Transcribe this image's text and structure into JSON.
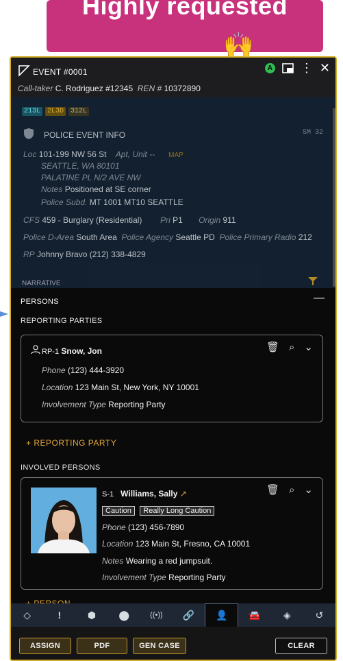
{
  "banner": {
    "text": "Highly requested",
    "emoji": "🙌"
  },
  "header": {
    "event_title": "EVENT #0001",
    "calltaker_label": "Call-taker",
    "calltaker_value": "C. Rodriguez #12345",
    "ren_label": "REN #",
    "ren_value": "10372890",
    "status_letter": "A"
  },
  "tags": [
    "213L",
    "2L3D",
    "312L"
  ],
  "police_info": {
    "title": "POLICE EVENT INFO",
    "sm": "SM 32",
    "loc_label": "Loc",
    "loc_value": "101-199 NW 56 St",
    "apt_label": "Apt, Unit --",
    "map_label": "MAP",
    "city": "SEATTLE, WA 80101",
    "cross": "PALATINE PL N/2 AVE NW",
    "notes_label": "Notes",
    "notes_value": "Positioned at SE corner",
    "subd_label": "Police Subd.",
    "subd_value": "MT 1001 MT10 SEATTLE",
    "cfs_label": "CFS",
    "cfs_value": "459 - Burglary (Residential)",
    "pri_label": "Pri",
    "pri_value": "P1",
    "origin_label": "Origin",
    "origin_value": "911",
    "darea_label": "Police D-Area",
    "darea_value": "South Area",
    "agency_label": "Police Agency",
    "agency_value": "Seattle PD",
    "radio_label": "Police Primary Radio",
    "radio_value": "212",
    "rp_label": "RP",
    "rp_value": "Johnny Bravo (212) 338-4829",
    "narrative_label": "NARRATIVE"
  },
  "persons": {
    "title": "PERSONS",
    "reporting_title": "REPORTING PARTIES",
    "rp_card": {
      "id": "RP-1",
      "name": "Snow, Jon",
      "phone_label": "Phone",
      "phone": "(123) 444-3920",
      "location_label": "Location",
      "location": "123 Main St, New York, NY 10001",
      "involvement_label": "Involvement Type",
      "involvement": "Reporting Party"
    },
    "add_rp": "+ REPORTING PARTY",
    "involved_title": "INVOLVED PERSONS",
    "s_card": {
      "id": "S-1",
      "name": "Williams, Sally",
      "caution1": "Caution",
      "caution2": "Really Long Caution",
      "phone_label": "Phone",
      "phone": "(123) 456-7890",
      "location_label": "Location",
      "location": "123 Main St, Fresno, CA 10001",
      "notes_label": "Notes",
      "notes": "Wearing a red jumpsuit.",
      "involvement_label": "Involvement Type",
      "involvement": "Reporting Party"
    },
    "add_person": "+ PERSON"
  },
  "actions": {
    "assign": "ASSIGN",
    "pdf": "PDF",
    "gen_case": "GEN CASE",
    "clear": "CLEAR"
  },
  "colors": {
    "banner": "#c8327d",
    "panel_border": "#d5b02a",
    "add_link": "#e0a63b",
    "status_green": "#2dbe4f"
  }
}
